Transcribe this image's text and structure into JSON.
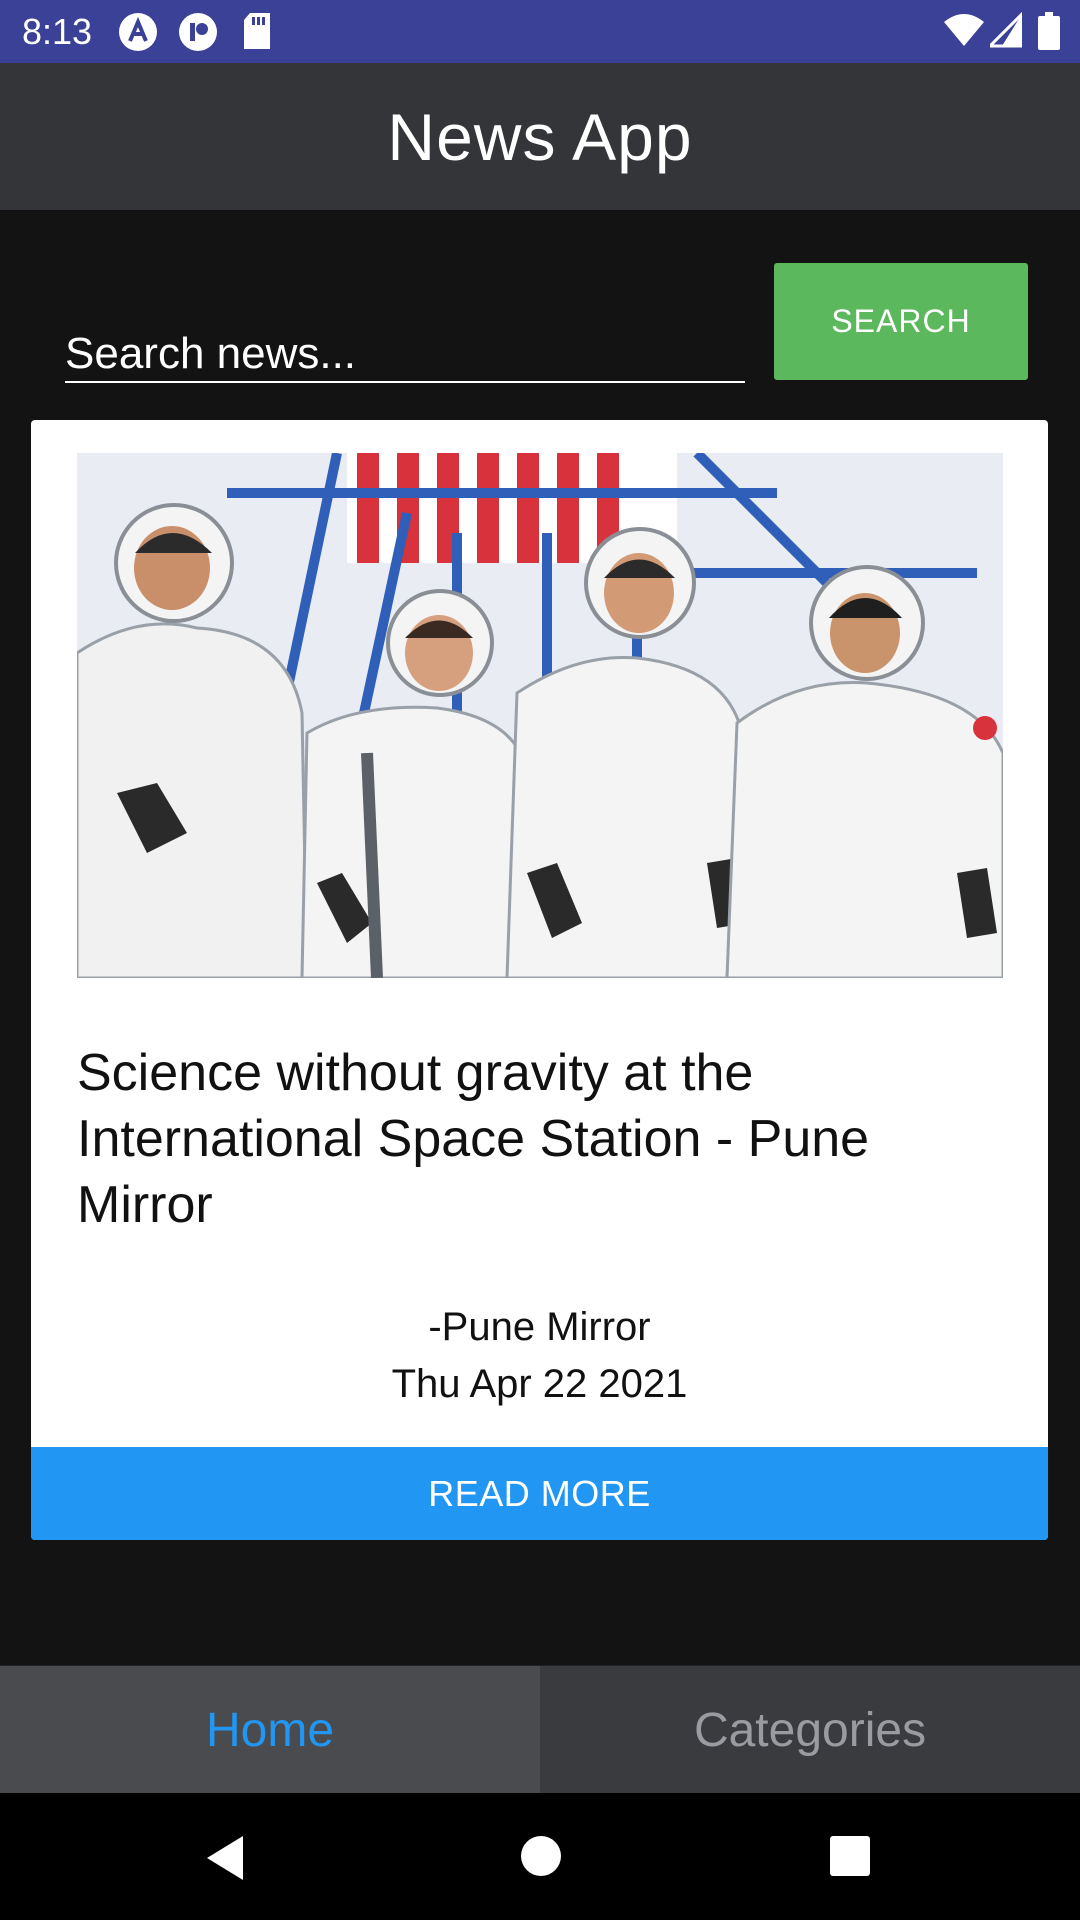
{
  "status_bar": {
    "time": "8:13",
    "icons": [
      "app-a-icon",
      "app-p-icon",
      "sd-card-icon",
      "wifi-icon",
      "cell-signal-icon",
      "battery-icon"
    ]
  },
  "app_bar": {
    "title": "News App"
  },
  "search": {
    "placeholder": "Search news...",
    "button_label": "SEARCH"
  },
  "article": {
    "image_desc": "astronauts-photo",
    "title": "Science without gravity at the International Space Station - Pune Mirror",
    "source": "-Pune Mirror",
    "date": "Thu Apr 22 2021",
    "read_more_label": "READ MORE"
  },
  "tabs": [
    {
      "label": "Home",
      "active": true
    },
    {
      "label": "Categories",
      "active": false
    }
  ],
  "colors": {
    "status_bar": "#3a4196",
    "app_bar": "#343538",
    "background": "#131313",
    "search_button": "#5cb85c",
    "read_more": "#2196f3",
    "active_tab_text": "#2196f3"
  }
}
